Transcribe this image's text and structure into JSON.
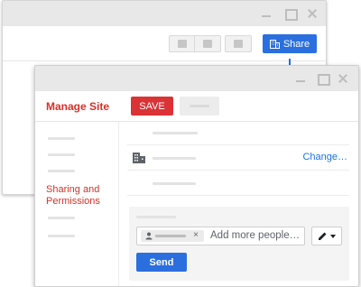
{
  "back_window": {
    "toolbar": {
      "share_label": "Share"
    },
    "icons": {
      "minimize": "minimize-icon",
      "maximize": "maximize-icon",
      "close": "close-icon",
      "building": "building-icon"
    }
  },
  "front_window": {
    "title": "Manage Site",
    "save_label": "SAVE",
    "sidebar": {
      "active_item": "Sharing and Permissions"
    },
    "change_link": "Change…",
    "share_panel": {
      "placeholder": "Add more people…",
      "chip_remove": "×",
      "send_label": "Send"
    }
  },
  "colors": {
    "accent_blue": "#2b6fde",
    "save_red": "#db3236",
    "title_red": "#d93025",
    "link_blue": "#1a73e8"
  }
}
